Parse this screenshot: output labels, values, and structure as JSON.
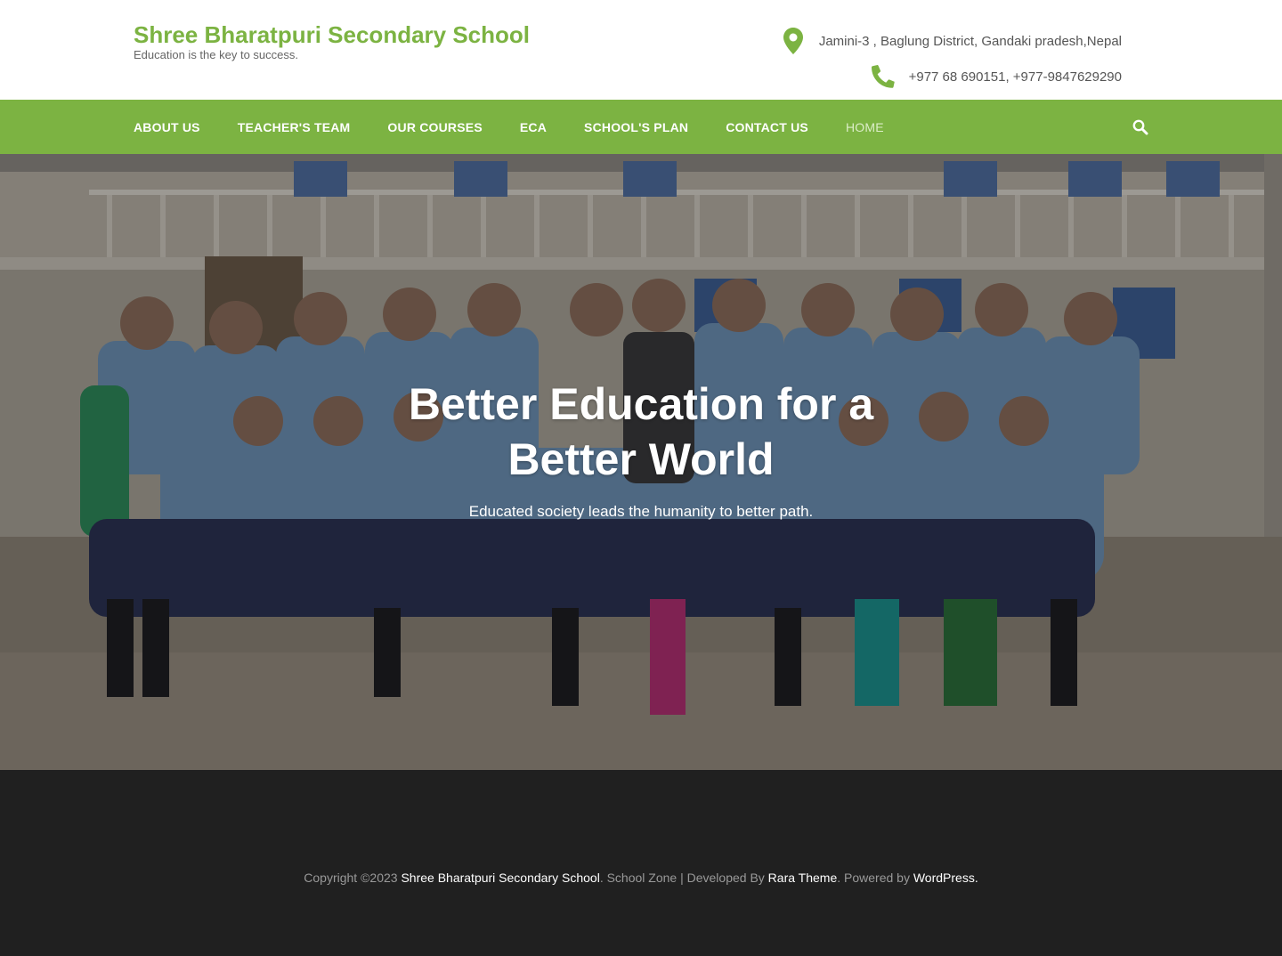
{
  "header": {
    "site_title": "Shree Bharatpuri Secondary School",
    "tagline": "Education is the key to success.",
    "address": "Jamini-3 , Baglung District, Gandaki pradesh,Nepal",
    "phone": "+977 68 690151, +977-9847629290",
    "address_icon": "map-marker-icon",
    "phone_icon": "phone-icon"
  },
  "nav": {
    "items": [
      {
        "label": "ABOUT US"
      },
      {
        "label": "TEACHER'S TEAM"
      },
      {
        "label": "OUR COURSES"
      },
      {
        "label": "ECA"
      },
      {
        "label": "SCHOOL'S PLAN"
      },
      {
        "label": "CONTACT US"
      },
      {
        "label": "HOME"
      }
    ],
    "search_icon": "search-icon"
  },
  "hero": {
    "title": "Better Education for a Better World",
    "subtitle": "Educated society leads the humanity to better path."
  },
  "footer": {
    "copyright_prefix": "Copyright ©2023",
    "site_link": "Shree Bharatpuri Secondary School",
    "middle_text": ". School Zone | Developed By",
    "theme_link": "Rara Theme",
    "powered_text": ". Powered by",
    "wp_link": "WordPress",
    "end_text": "."
  },
  "colors": {
    "brand_green": "#7cb342",
    "footer_bg": "#202020",
    "current_nav": "#dcedc8"
  }
}
